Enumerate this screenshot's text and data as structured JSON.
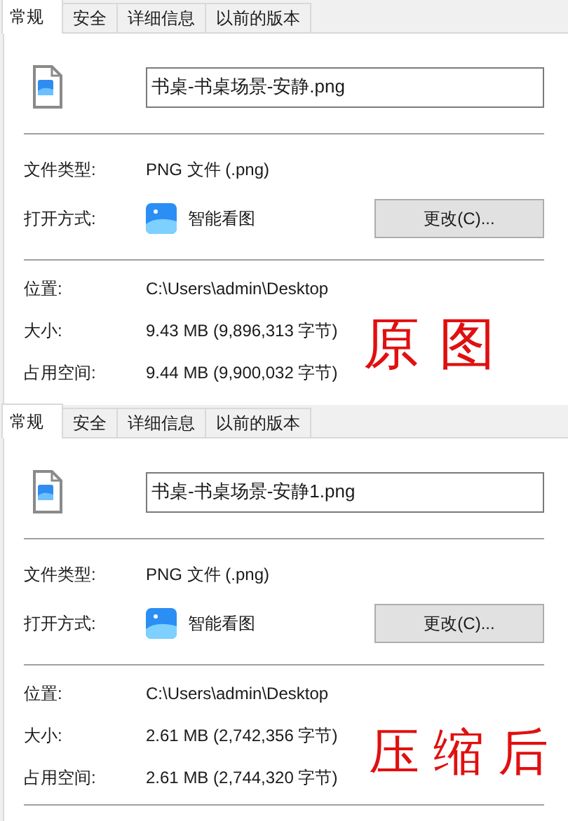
{
  "panels": [
    {
      "tabs": [
        {
          "label": "常规",
          "selected": true
        },
        {
          "label": "安全",
          "selected": false
        },
        {
          "label": "详细信息",
          "selected": false
        },
        {
          "label": "以前的版本",
          "selected": false
        }
      ],
      "file_name": "书桌-书桌场景-安静.png",
      "file_type": {
        "label": "文件类型:",
        "value": "PNG 文件 (.png)"
      },
      "open_with": {
        "label": "打开方式:",
        "app": "智能看图",
        "button": "更改(C)..."
      },
      "details": [
        {
          "label": "位置:",
          "value": "C:\\Users\\admin\\Desktop"
        },
        {
          "label": "大小:",
          "value": "9.43 MB (9,896,313 字节)"
        },
        {
          "label": "占用空间:",
          "value": "9.44 MB (9,900,032 字节)"
        }
      ],
      "annotation": "原图"
    },
    {
      "tabs": [
        {
          "label": "常规",
          "selected": true
        },
        {
          "label": "安全",
          "selected": false
        },
        {
          "label": "详细信息",
          "selected": false
        },
        {
          "label": "以前的版本",
          "selected": false
        }
      ],
      "file_name": "书桌-书桌场景-安静1.png",
      "file_type": {
        "label": "文件类型:",
        "value": "PNG 文件 (.png)"
      },
      "open_with": {
        "label": "打开方式:",
        "app": "智能看图",
        "button": "更改(C)..."
      },
      "details": [
        {
          "label": "位置:",
          "value": "C:\\Users\\admin\\Desktop"
        },
        {
          "label": "大小:",
          "value": "2.61 MB (2,742,356 字节)"
        },
        {
          "label": "占用空间:",
          "value": "2.61 MB (2,744,320 字节)"
        }
      ],
      "annotation": "压缩后"
    }
  ]
}
